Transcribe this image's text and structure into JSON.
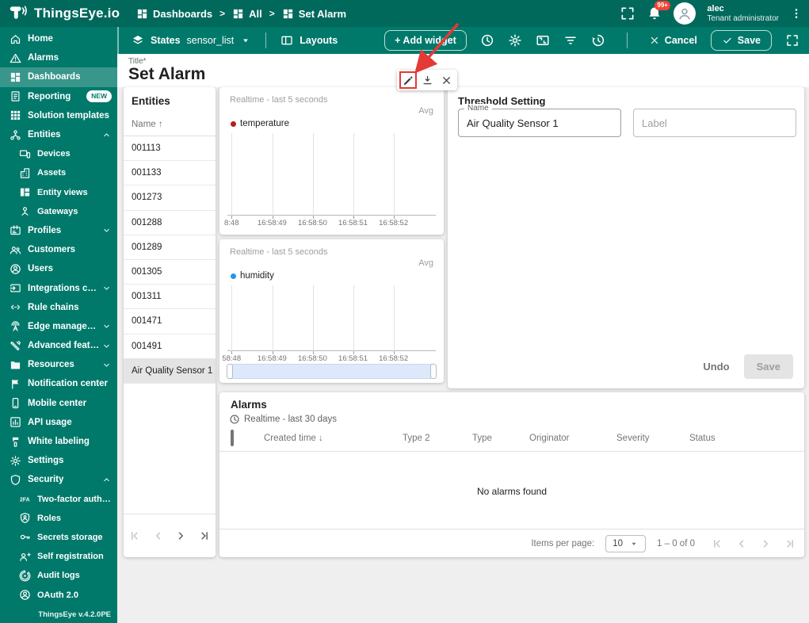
{
  "colors": {
    "header_bg": "#00695c",
    "sidebar_bg": "#00796b",
    "annotation_red": "#e53935",
    "temperature_series": "#b71c1c",
    "humidity_series": "#2196f3"
  },
  "header": {
    "logo_text": "ThingsEye.io",
    "breadcrumb_separator": ">",
    "breadcrumbs": [
      "Dashboards",
      "All",
      "Set Alarm"
    ],
    "notification_badge": "99+",
    "user": {
      "name": "alec",
      "role": "Tenant administrator"
    }
  },
  "dashboard_toolbar": {
    "states_label": "States",
    "state_value": "sensor_list",
    "layouts_label": "Layouts",
    "add_widget_label": "+ Add widget",
    "cancel_label": "Cancel",
    "save_label": "Save"
  },
  "sidebar": {
    "version": "ThingsEye v.4.2.0PE",
    "items": [
      {
        "label": "Home",
        "icon": "home"
      },
      {
        "label": "Alarms",
        "icon": "warning"
      },
      {
        "label": "Dashboards",
        "icon": "dashboard",
        "selected": true
      },
      {
        "label": "Reporting",
        "icon": "report",
        "badge": "NEW"
      },
      {
        "label": "Solution templates",
        "icon": "apps"
      },
      {
        "label": "Entities",
        "icon": "hierarchy",
        "chevron": "up"
      },
      {
        "label": "Devices",
        "icon": "devices",
        "child": true
      },
      {
        "label": "Assets",
        "icon": "building",
        "child": true
      },
      {
        "label": "Entity views",
        "icon": "quilt",
        "child": true
      },
      {
        "label": "Gateways",
        "icon": "hub",
        "child": true
      },
      {
        "label": "Profiles",
        "icon": "badge",
        "chevron": "down"
      },
      {
        "label": "Customers",
        "icon": "people"
      },
      {
        "label": "Users",
        "icon": "person-circle"
      },
      {
        "label": "Integrations center",
        "icon": "input",
        "chevron": "down"
      },
      {
        "label": "Rule chains",
        "icon": "ethernet"
      },
      {
        "label": "Edge management",
        "icon": "antenna",
        "chevron": "down"
      },
      {
        "label": "Advanced features",
        "icon": "tools",
        "chevron": "down"
      },
      {
        "label": "Resources",
        "icon": "folder",
        "chevron": "down"
      },
      {
        "label": "Notification center",
        "icon": "flag"
      },
      {
        "label": "Mobile center",
        "icon": "phone"
      },
      {
        "label": "API usage",
        "icon": "chart"
      },
      {
        "label": "White labeling",
        "icon": "paint"
      },
      {
        "label": "Settings",
        "icon": "gear"
      },
      {
        "label": "Security",
        "icon": "shield",
        "chevron": "up"
      },
      {
        "label": "Two-factor authenticati...",
        "icon": "twofa",
        "child": true
      },
      {
        "label": "Roles",
        "icon": "shield-person",
        "child": true
      },
      {
        "label": "Secrets storage",
        "icon": "key",
        "child": true
      },
      {
        "label": "Self registration",
        "icon": "person-add",
        "child": true
      },
      {
        "label": "Audit logs",
        "icon": "track",
        "child": true
      },
      {
        "label": "OAuth 2.0",
        "icon": "oauth",
        "child": true
      }
    ]
  },
  "page": {
    "title_label": "Title*",
    "title": "Set Alarm"
  },
  "entities": {
    "title": "Entities",
    "column": "Name",
    "sort_indicator": "↑",
    "rows": [
      "001113",
      "001133",
      "001273",
      "001288",
      "001289",
      "001305",
      "001311",
      "001471",
      "001491",
      "Air Quality Sensor 1"
    ],
    "selected_row": "Air Quality Sensor 1"
  },
  "charts": [
    {
      "timewindow": "Realtime - last 5 seconds",
      "aggregation": "Avg",
      "series": "temperature",
      "color": "#b71c1c",
      "ticks": [
        "8:48",
        "16:58:49",
        "16:58:50",
        "16:58:51",
        "16:58:52"
      ],
      "has_brush": false
    },
    {
      "timewindow": "Realtime - last 5 seconds",
      "aggregation": "Avg",
      "series": "humidity",
      "color": "#2196f3",
      "ticks": [
        "58:48",
        "16:58:49",
        "16:58:50",
        "16:58:51",
        "16:58:52"
      ],
      "has_brush": true
    }
  ],
  "widget_actions": {
    "edit": "edit",
    "download": "download",
    "close": "close"
  },
  "threshold": {
    "title": "Threshold Setting",
    "name_label": "Name",
    "name_value": "Air Quality Sensor 1",
    "label_placeholder": "Label",
    "undo_label": "Undo",
    "save_label": "Save"
  },
  "alarms": {
    "title": "Alarms",
    "timewindow": "Realtime - last 30 days",
    "sort_indicator": "↓",
    "sorted_column": "Created time",
    "columns": [
      "Created time",
      "Type 2",
      "Type",
      "Originator",
      "Severity",
      "Status"
    ],
    "empty_text": "No alarms found",
    "items_per_page_label": "Items per page:",
    "page_size": "10",
    "range_text": "1 – 0 of 0"
  }
}
